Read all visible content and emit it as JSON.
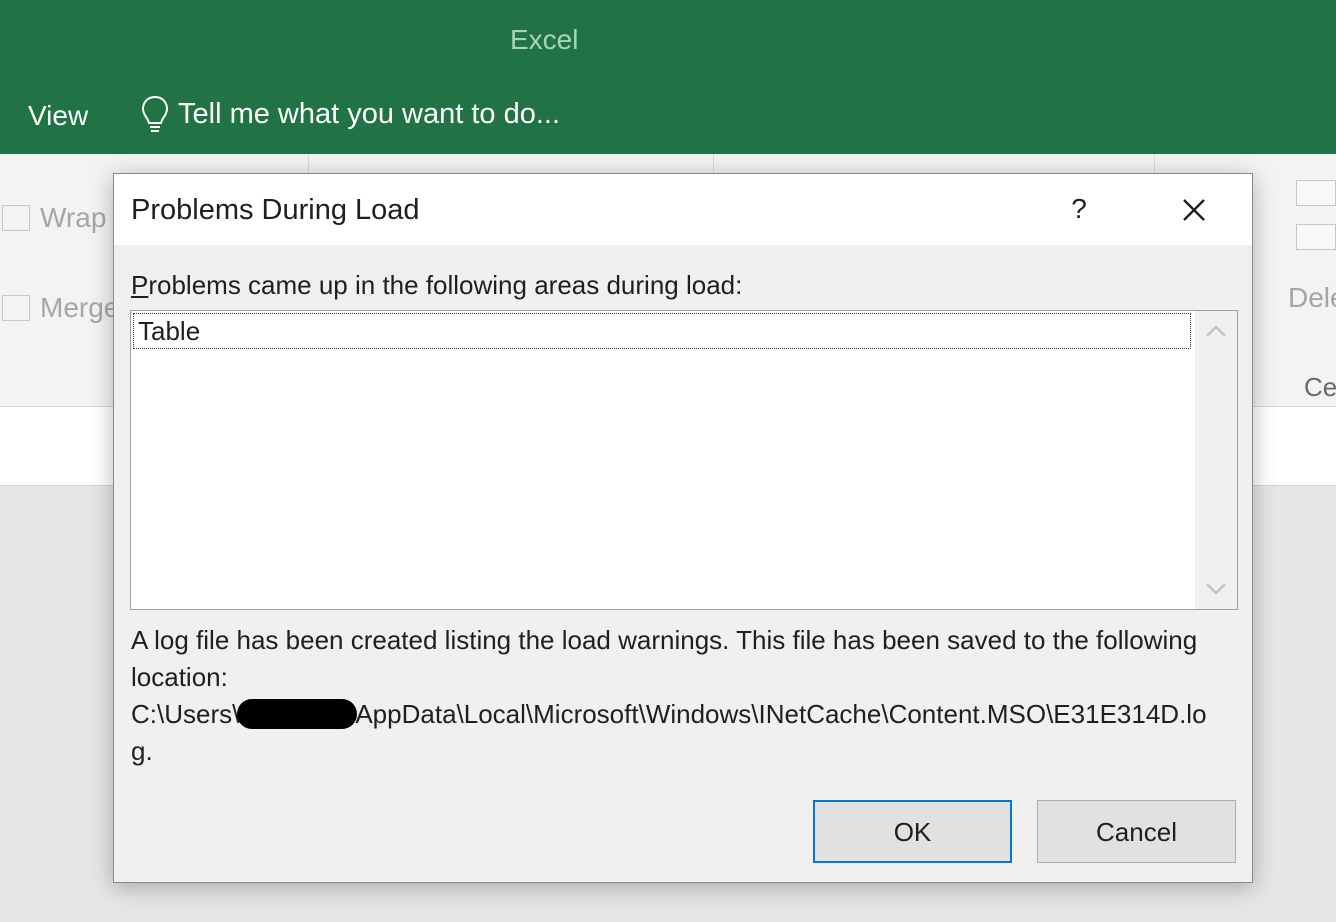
{
  "app": {
    "title": "Excel",
    "ribbon_tab": "View",
    "tell_me_placeholder": "Tell me what you want to do..."
  },
  "ribbon": {
    "wrap_label": "Wrap",
    "merge_label": "Merge",
    "delete_label": "Delete",
    "cells_group_label": "Cells"
  },
  "dialog": {
    "title": "Problems During Load",
    "help_glyph": "?",
    "label_access_key": "P",
    "label_rest": "roblems came up in the following areas during load:",
    "list_items": [
      "Table"
    ],
    "message_line1": "A log file has been created listing the load warnings.  This file has been saved to the following location:",
    "path_prefix": "C:\\Users\\",
    "path_suffix": "AppData\\Local\\Microsoft\\Windows\\INetCache\\Content.MSO\\E31E314D.lo",
    "path_tail": "g.",
    "ok_label": "OK",
    "cancel_label": "Cancel"
  },
  "colors": {
    "excel_green": "#217346",
    "focus_blue": "#0078d7",
    "dialog_bg": "#f0f0f0"
  },
  "icons": [
    "lightbulb-icon",
    "help-icon",
    "close-icon",
    "scroll-up-icon",
    "scroll-down-icon"
  ]
}
